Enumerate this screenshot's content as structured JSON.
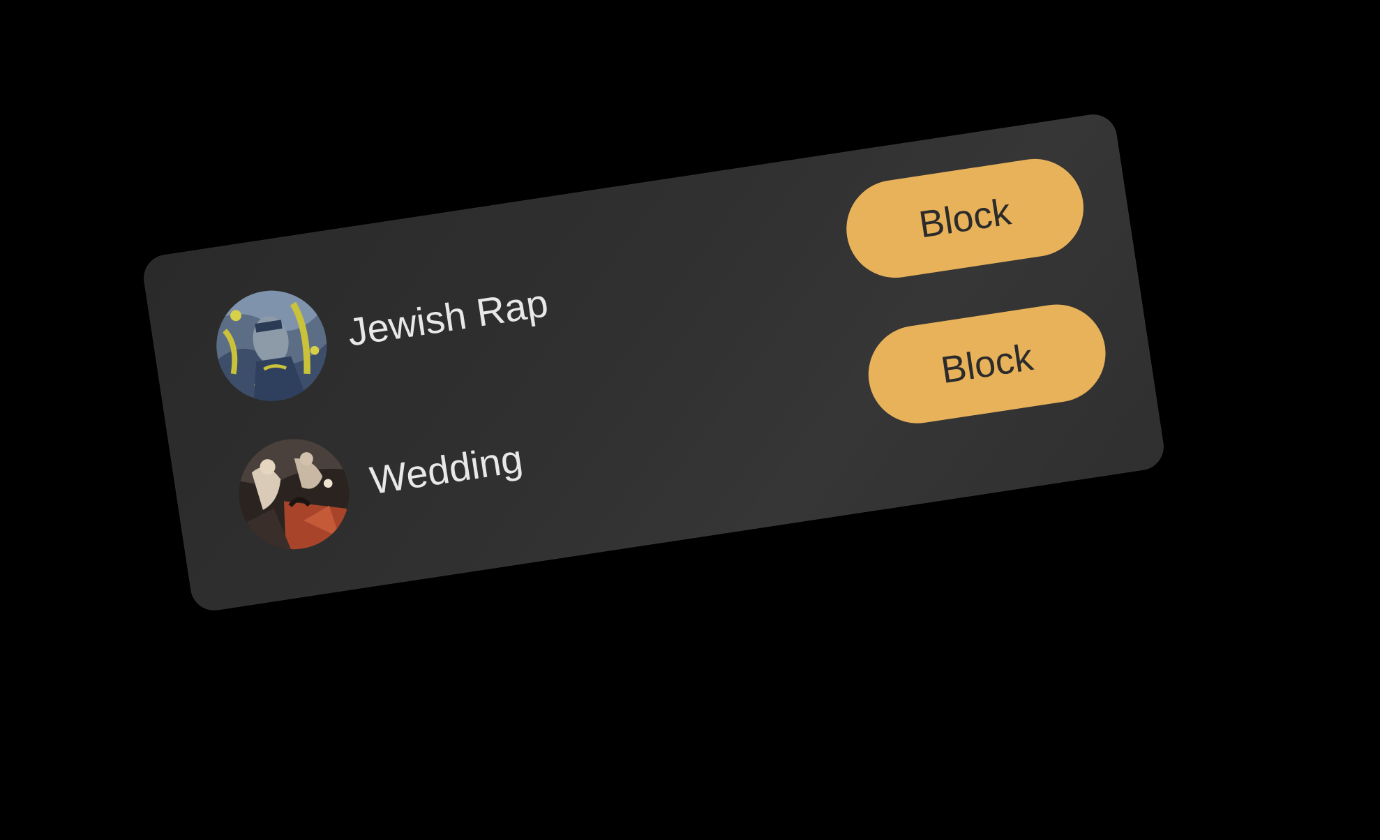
{
  "blocklist": {
    "items": [
      {
        "name": "Jewish Rap",
        "action_label": "Block",
        "avatar_icon": "album-art-portrait-icon"
      },
      {
        "name": "Wedding",
        "action_label": "Block",
        "avatar_icon": "album-art-wedding-icon"
      }
    ]
  },
  "colors": {
    "background": "#000000",
    "card": "#303030",
    "accent": "#e8b25a",
    "button_text": "#2b2b2b",
    "item_text": "#e8e8e8"
  }
}
